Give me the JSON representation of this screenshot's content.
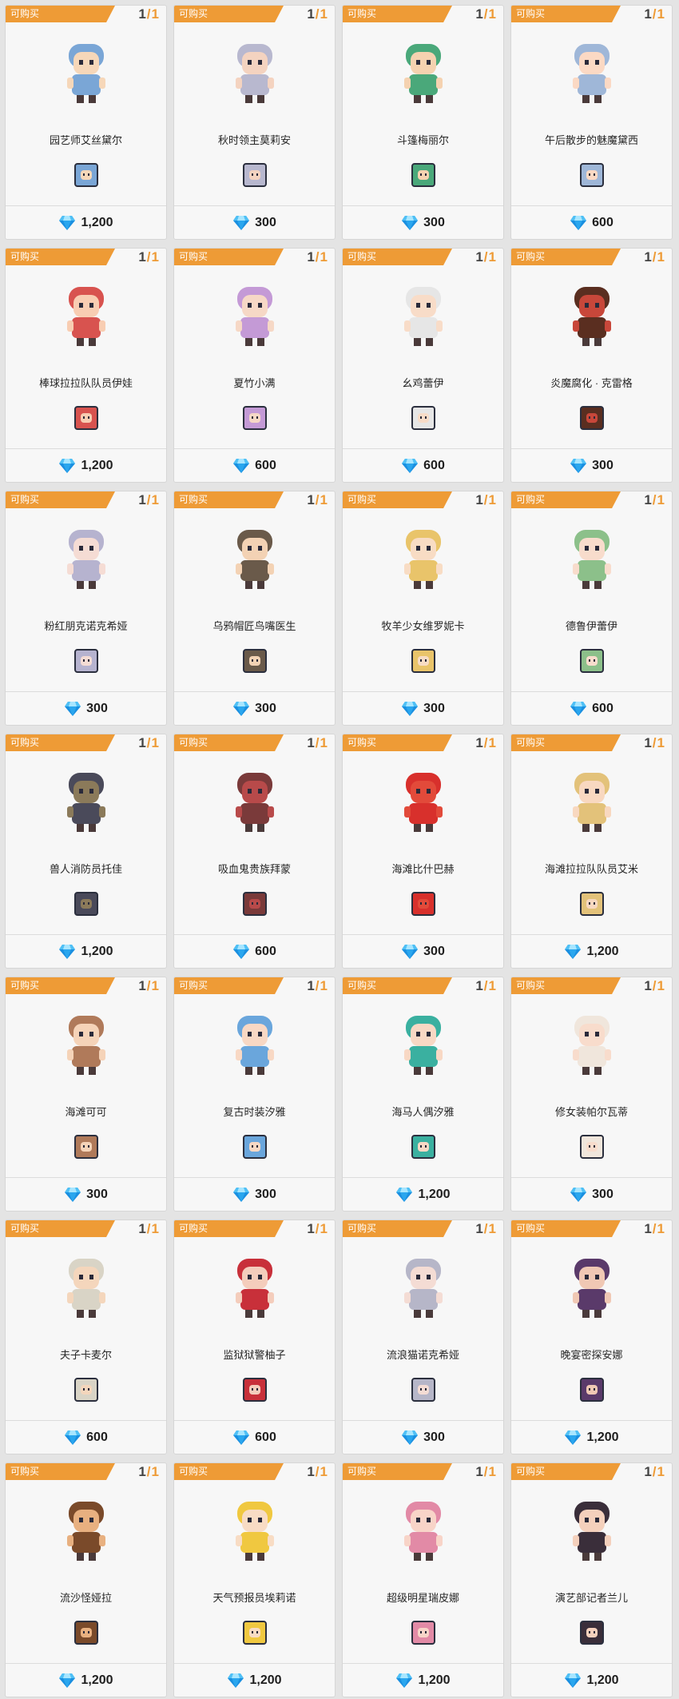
{
  "shop": {
    "tag_label": "可购买",
    "currency_icon": "diamond-icon",
    "items": [
      {
        "name": "园艺师艾丝黛尔",
        "count": "1",
        "max": "1",
        "price": "1,200",
        "accent": "#7aa6d6",
        "skin": "#f6d7b9"
      },
      {
        "name": "秋时领主莫莉安",
        "count": "1",
        "max": "1",
        "price": "300",
        "accent": "#b8b8cf",
        "skin": "#f4d3c0"
      },
      {
        "name": "斗篷梅丽尔",
        "count": "1",
        "max": "1",
        "price": "300",
        "accent": "#4aa87a",
        "skin": "#f5d2b0"
      },
      {
        "name": "午后散步的魅魔黛西",
        "count": "1",
        "max": "1",
        "price": "600",
        "accent": "#9fb7d8",
        "skin": "#fbd9c4"
      },
      {
        "name": "棒球拉拉队队员伊娃",
        "count": "1",
        "max": "1",
        "price": "1,200",
        "accent": "#d8534f",
        "skin": "#f8cdb2"
      },
      {
        "name": "夏竹小满",
        "count": "1",
        "max": "1",
        "price": "600",
        "accent": "#c49ad6",
        "skin": "#f6d8c6"
      },
      {
        "name": "幺鸡蕾伊",
        "count": "1",
        "max": "1",
        "price": "600",
        "accent": "#e6e6e6",
        "skin": "#f8dcc8"
      },
      {
        "name": "炎魔腐化 · 克雷格",
        "count": "1",
        "max": "1",
        "price": "300",
        "accent": "#5a2e20",
        "skin": "#c8473a"
      },
      {
        "name": "粉红朋克诺克希娅",
        "count": "1",
        "max": "1",
        "price": "300",
        "accent": "#b6b3cf",
        "skin": "#f5dcd4"
      },
      {
        "name": "乌鸦帽匠鸟嘴医生",
        "count": "1",
        "max": "1",
        "price": "300",
        "accent": "#6a5a4a",
        "skin": "#f3d2b4"
      },
      {
        "name": "牧羊少女维罗妮卡",
        "count": "1",
        "max": "1",
        "price": "300",
        "accent": "#e9c46a",
        "skin": "#f8dcc4"
      },
      {
        "name": "德鲁伊蕾伊",
        "count": "1",
        "max": "1",
        "price": "600",
        "accent": "#8cc08a",
        "skin": "#f8dccc"
      },
      {
        "name": "兽人消防员托佳",
        "count": "1",
        "max": "1",
        "price": "1,200",
        "accent": "#4a4a5a",
        "skin": "#8b7a5a"
      },
      {
        "name": "吸血鬼贵族拜蒙",
        "count": "1",
        "max": "1",
        "price": "600",
        "accent": "#7a3a3a",
        "skin": "#b84a4a"
      },
      {
        "name": "海滩比什巴赫",
        "count": "1",
        "max": "1",
        "price": "300",
        "accent": "#d8302c",
        "skin": "#e24a3a"
      },
      {
        "name": "海滩拉拉队队员艾米",
        "count": "1",
        "max": "1",
        "price": "1,200",
        "accent": "#e3c27a",
        "skin": "#f8d8c0"
      },
      {
        "name": "海滩可可",
        "count": "1",
        "max": "1",
        "price": "300",
        "accent": "#b07a5a",
        "skin": "#f5d3b8"
      },
      {
        "name": "复古时装汐雅",
        "count": "1",
        "max": "1",
        "price": "300",
        "accent": "#6aa6dc",
        "skin": "#f8d8c4"
      },
      {
        "name": "海马人偶汐雅",
        "count": "1",
        "max": "1",
        "price": "1,200",
        "accent": "#3ab0a0",
        "skin": "#f8d8c4"
      },
      {
        "name": "修女装帕尔瓦蒂",
        "count": "1",
        "max": "1",
        "price": "300",
        "accent": "#f0e6dc",
        "skin": "#f8dccc"
      },
      {
        "name": "夫子卡麦尔",
        "count": "1",
        "max": "1",
        "price": "600",
        "accent": "#d9d4c6",
        "skin": "#f4d6bc"
      },
      {
        "name": "监狱狱警柚子",
        "count": "1",
        "max": "1",
        "price": "600",
        "accent": "#c8303a",
        "skin": "#f4cdbc"
      },
      {
        "name": "流浪猫诺克希娅",
        "count": "1",
        "max": "1",
        "price": "300",
        "accent": "#b6b6c8",
        "skin": "#f4dcd4"
      },
      {
        "name": "晚宴密探安娜",
        "count": "1",
        "max": "1",
        "price": "1,200",
        "accent": "#5a3a6a",
        "skin": "#f0c8b4"
      },
      {
        "name": "流沙怪娅拉",
        "count": "1",
        "max": "1",
        "price": "1,200",
        "accent": "#7a4a2a",
        "skin": "#e8b080"
      },
      {
        "name": "天气预报员埃莉诺",
        "count": "1",
        "max": "1",
        "price": "1,200",
        "accent": "#f0c840",
        "skin": "#f8dcc4"
      },
      {
        "name": "超级明星瑞皮娜",
        "count": "1",
        "max": "1",
        "price": "1,200",
        "accent": "#e28aa6",
        "skin": "#f8d4c8"
      },
      {
        "name": "演艺部记者兰儿",
        "count": "1",
        "max": "1",
        "price": "1,200",
        "accent": "#3a2e3a",
        "skin": "#f4d0bc"
      }
    ]
  }
}
